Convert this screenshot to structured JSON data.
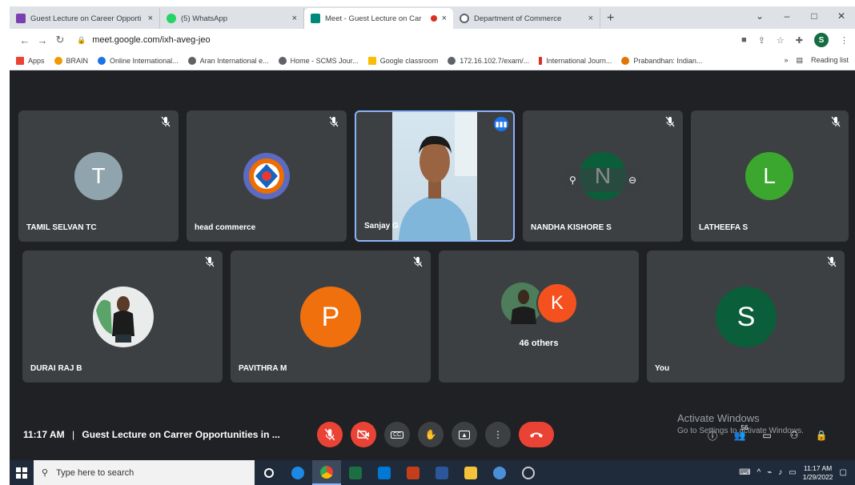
{
  "browser": {
    "tabs": [
      {
        "title": "Guest Lecture on Career Opporti",
        "favicon_color": "#7b3fb0",
        "close": "×"
      },
      {
        "title": "(5) WhatsApp",
        "favicon_color": "#25d366",
        "close": "×"
      },
      {
        "title": "Meet - Guest Lecture on Car",
        "favicon_color": "#00897b",
        "close": "×"
      },
      {
        "title": "Department of Commerce",
        "favicon_color": "#5f6368",
        "close": "×"
      }
    ],
    "new_tab": "+",
    "window_controls": [
      "⌄",
      "–",
      "□",
      "✕"
    ],
    "url": "meet.google.com/ixh-aveg-jeo",
    "profile_initial": "S",
    "bookmarks": [
      {
        "label": "Apps",
        "color": "#ea4335"
      },
      {
        "label": "BRAIN",
        "color": "#f29900"
      },
      {
        "label": "Online International...",
        "color": "#1a73e8"
      },
      {
        "label": "Aran International e...",
        "color": "#5f6368"
      },
      {
        "label": "Home - SCMS Jour...",
        "color": "#5f6368"
      },
      {
        "label": "Google classroom",
        "color": "#fbbc04"
      },
      {
        "label": "172.16.102.7/exam/...",
        "color": "#5f6368"
      },
      {
        "label": "International Journ...",
        "color": "#d93025"
      },
      {
        "label": "Prabandhan: Indian...",
        "color": "#e37400"
      }
    ],
    "bookmarks_more": "»",
    "reading_list": "Reading list"
  },
  "meet": {
    "participants": [
      {
        "name": "TAMIL SELVAN TC",
        "initial": "T",
        "color": "#90a4ae"
      },
      {
        "name": "head commerce",
        "initial": "",
        "color": "#5c6bc0"
      },
      {
        "name": "Sanjay G",
        "initial": "",
        "color": "#d6e6f0"
      },
      {
        "name": "NANDHA KISHORE S",
        "initial": "N",
        "color": "#0b5e3a"
      },
      {
        "name": "LATHEEFA S",
        "initial": "L",
        "color": "#3ba72e"
      },
      {
        "name": "DURAI RAJ B",
        "initial": "",
        "color": "#e6e6e6"
      },
      {
        "name": "PAVITHRA M",
        "initial": "P",
        "color": "#f0700e"
      },
      {
        "name": "46 others",
        "initial": "K",
        "color": "#f4511e"
      },
      {
        "name": "You",
        "initial": "S",
        "color": "#0b5e3a"
      }
    ],
    "time": "11:17 AM",
    "separator": "|",
    "meeting_title": "Guest Lecture on Carrer Opportunities in ...",
    "activate_title": "Activate Windows",
    "activate_sub": "Go to Settings to activate Windows.",
    "people_count": "56"
  },
  "taskbar": {
    "search_placeholder": "Type here to search",
    "clock_time": "11:17 AM",
    "clock_date": "1/29/2022"
  }
}
